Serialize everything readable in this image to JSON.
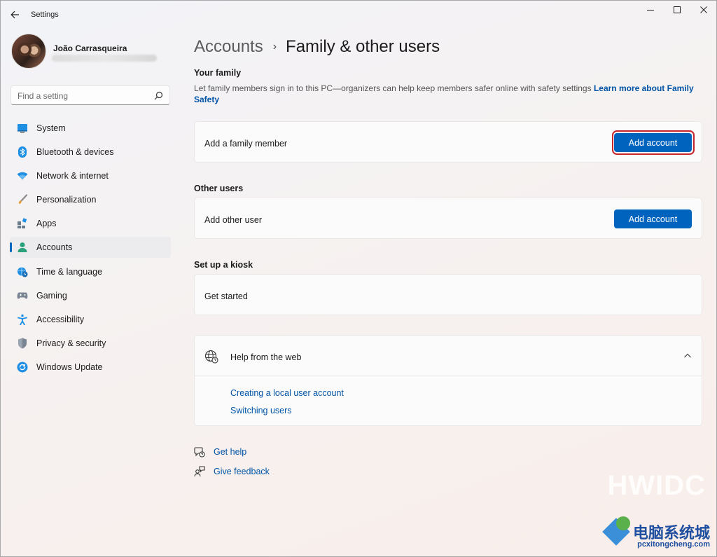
{
  "window": {
    "title": "Settings"
  },
  "profile": {
    "name": "João Carrasqueira"
  },
  "search": {
    "placeholder": "Find a setting"
  },
  "sidebar": {
    "items": [
      {
        "label": "System",
        "icon": "system-icon",
        "active": false
      },
      {
        "label": "Bluetooth & devices",
        "icon": "bluetooth-icon",
        "active": false
      },
      {
        "label": "Network & internet",
        "icon": "wifi-icon",
        "active": false
      },
      {
        "label": "Personalization",
        "icon": "brush-icon",
        "active": false
      },
      {
        "label": "Apps",
        "icon": "apps-icon",
        "active": false
      },
      {
        "label": "Accounts",
        "icon": "person-icon",
        "active": true
      },
      {
        "label": "Time & language",
        "icon": "globe-clock-icon",
        "active": false
      },
      {
        "label": "Gaming",
        "icon": "gamepad-icon",
        "active": false
      },
      {
        "label": "Accessibility",
        "icon": "accessibility-icon",
        "active": false
      },
      {
        "label": "Privacy & security",
        "icon": "shield-icon",
        "active": false
      },
      {
        "label": "Windows Update",
        "icon": "update-icon",
        "active": false
      }
    ]
  },
  "breadcrumb": {
    "parent": "Accounts",
    "separator": "›",
    "current": "Family & other users"
  },
  "family": {
    "title": "Your family",
    "description": "Let family members sign in to this PC—organizers can help keep members safer online with safety settings",
    "link": "Learn more about Family Safety",
    "card_label": "Add a family member",
    "button": "Add account"
  },
  "other_users": {
    "title": "Other users",
    "card_label": "Add other user",
    "button": "Add account"
  },
  "kiosk": {
    "title": "Set up a kiosk",
    "card_label": "Get started"
  },
  "help": {
    "title": "Help from the web",
    "links": [
      "Creating a local user account",
      "Switching users"
    ]
  },
  "footer": {
    "get_help": "Get help",
    "give_feedback": "Give feedback"
  },
  "watermark": {
    "brand": "HWIDC",
    "cn_text": "电脑系统城",
    "url": "pcxitongcheng.com"
  },
  "colors": {
    "accent": "#0063be",
    "link": "#0054a6",
    "highlight": "#c4242c"
  }
}
